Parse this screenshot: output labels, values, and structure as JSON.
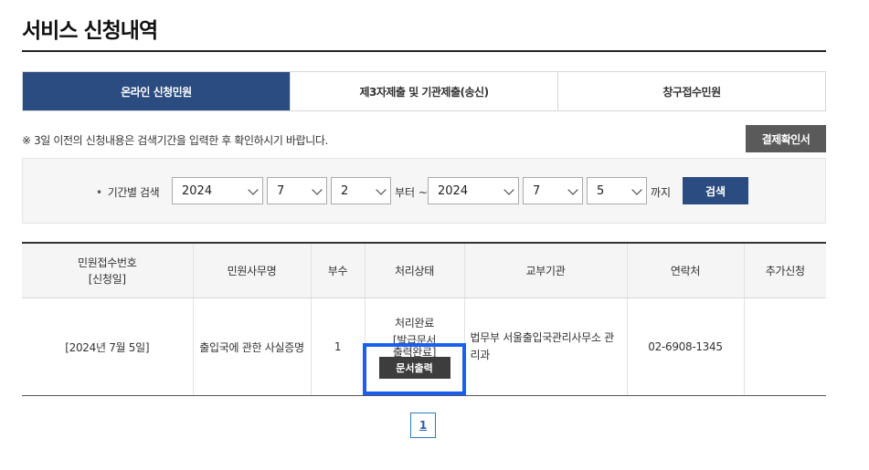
{
  "page": {
    "title": "서비스 신청내역"
  },
  "tabs": [
    {
      "label": "온라인 신청민원",
      "active": true
    },
    {
      "label": "제3자제출 및 기관제출(송신)",
      "active": false
    },
    {
      "label": "창구접수민원",
      "active": false
    }
  ],
  "notice": "※ 3일 이전의 신청내용은 검색기간을 입력한 후 확인하시기 바랍니다.",
  "confirm_button": "결제확인서",
  "search": {
    "label": "기간별 검색",
    "from": {
      "year": "2024",
      "month": "7",
      "day": "2"
    },
    "from_suffix": "부터 ~",
    "to": {
      "year": "2024",
      "month": "7",
      "day": "5"
    },
    "to_suffix": "까지",
    "button": "검색"
  },
  "table": {
    "headers": {
      "receipt_no": "민원접수번호",
      "receipt_sub": "[신청일]",
      "name": "민원사무명",
      "copies": "부수",
      "status": "처리상태",
      "agency": "교부기관",
      "contact": "연락처",
      "extra": "추가신청"
    },
    "rows": [
      {
        "date": "[2024년 7월 5일]",
        "name": "출입국에 관한 사실증명",
        "copies": "1",
        "status_line1": "처리완료",
        "status_line2": "[발급문서",
        "status_line3": "출력완료]",
        "print_button": "문서출력",
        "agency": "법무부 서울출입국관리사무소 관리과",
        "contact": "02-6908-1345",
        "extra": ""
      }
    ]
  },
  "pagination": {
    "current": "1"
  },
  "colors": {
    "primary": "#2b4c80",
    "highlight": "#1a5ff0"
  }
}
